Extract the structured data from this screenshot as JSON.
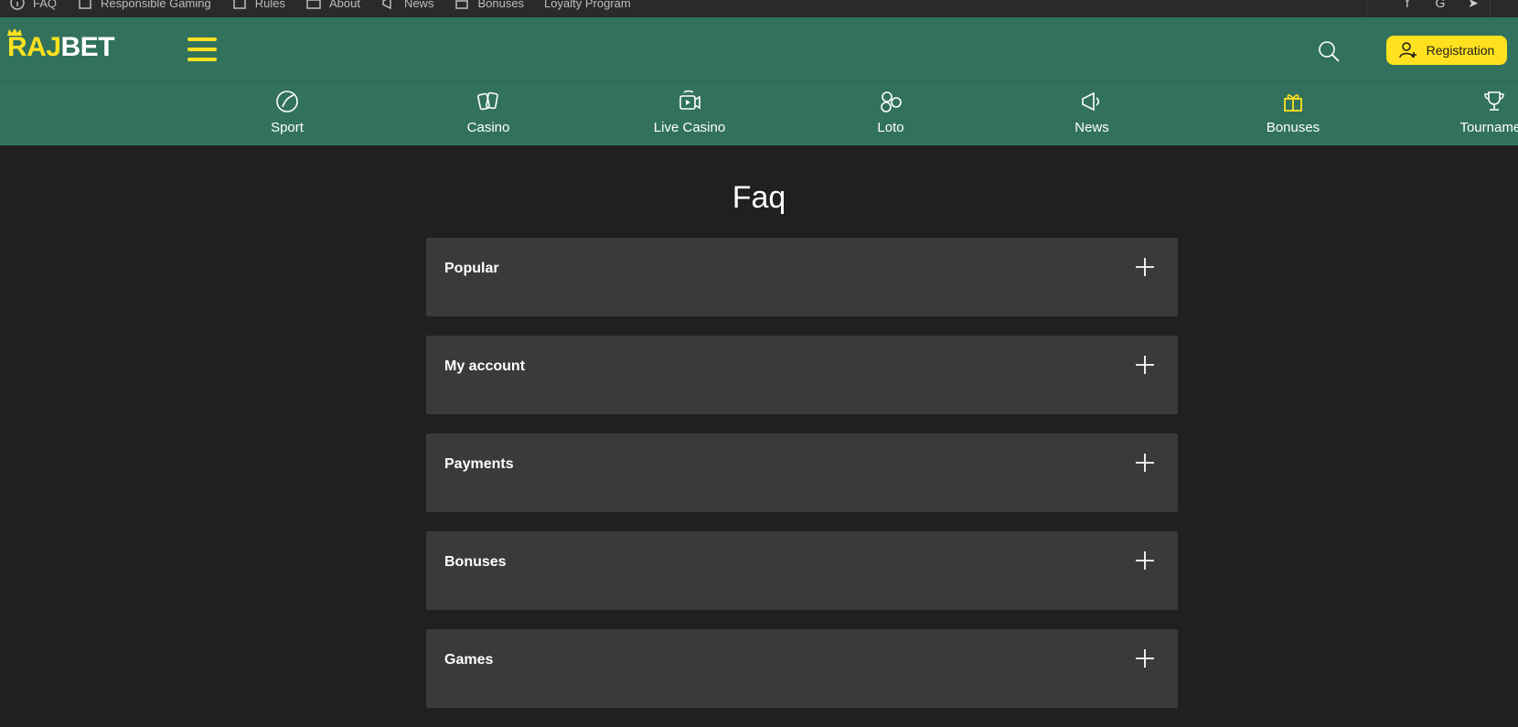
{
  "topbar": {
    "links": [
      {
        "label": "FAQ",
        "icon": "info-icon"
      },
      {
        "label": "Responsible Gaming",
        "icon": "shield-icon"
      },
      {
        "label": "Rules",
        "icon": "rules-icon"
      },
      {
        "label": "About",
        "icon": "building-icon"
      },
      {
        "label": "News",
        "icon": "megaphone-icon"
      },
      {
        "label": "Bonuses",
        "icon": "gift-icon"
      },
      {
        "label": "Loyalty Program",
        "icon": ""
      }
    ]
  },
  "header": {
    "logo_part1": "RAJ",
    "logo_part2": "BET",
    "registration_label": "Registration"
  },
  "categories": [
    {
      "label": "Sport",
      "icon": "ball-icon"
    },
    {
      "label": "Casino",
      "icon": "cards-icon"
    },
    {
      "label": "Live Casino",
      "icon": "live-video-icon"
    },
    {
      "label": "Loto",
      "icon": "lottery-balls-icon"
    },
    {
      "label": "News",
      "icon": "megaphone-icon"
    },
    {
      "label": "Bonuses",
      "icon": "gift-icon"
    },
    {
      "label": "Tournamen",
      "icon": "trophy-icon"
    }
  ],
  "page": {
    "title": "Faq"
  },
  "faq": [
    {
      "label": "Popular"
    },
    {
      "label": "My account"
    },
    {
      "label": "Payments"
    },
    {
      "label": "Bonuses"
    },
    {
      "label": "Games"
    }
  ],
  "colors": {
    "header_bg": "#32725c",
    "accent_yellow": "#ffe11f",
    "page_bg": "#202020",
    "card_bg": "#3a3a3a"
  }
}
